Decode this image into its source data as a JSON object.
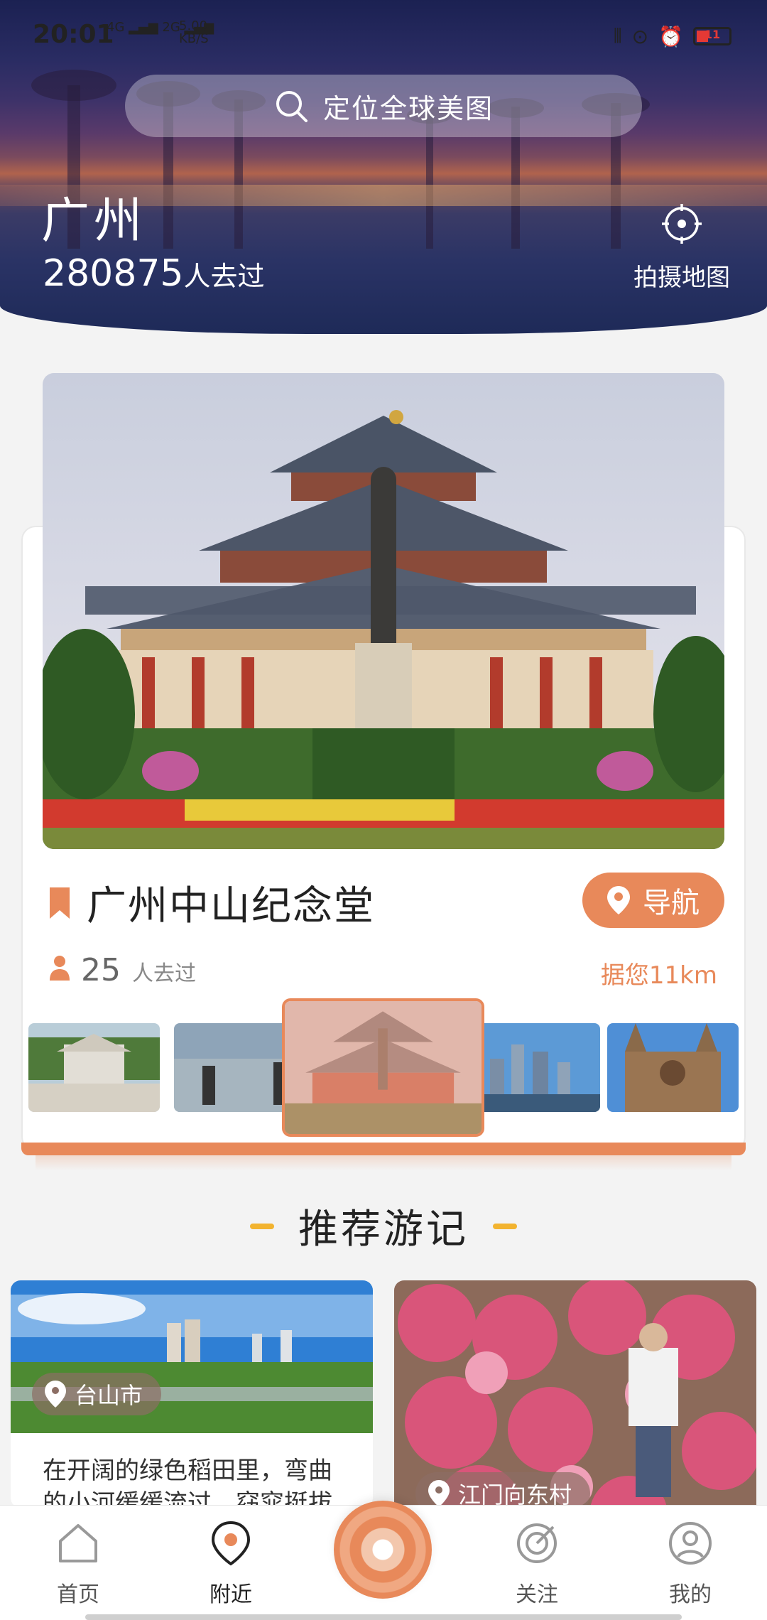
{
  "status_bar": {
    "time": "20:01",
    "network_1": "4G",
    "network_2": "2G",
    "speed": "5.00",
    "speed_unit": "KB/S",
    "battery": "11"
  },
  "search": {
    "placeholder": "定位全球美图"
  },
  "hero": {
    "city": "广州",
    "visit_count": "280875",
    "visit_label": "人去过",
    "photo_map_label": "拍摄地图"
  },
  "poi": {
    "name": "广州中山纪念堂",
    "nav_label": "导航",
    "visited_count": "25",
    "visited_label": "人去过",
    "distance": "据您11km",
    "thumbnails": [
      "thumb-1",
      "thumb-2",
      "thumb-3-active",
      "thumb-4",
      "thumb-5"
    ]
  },
  "section": {
    "title": "推荐游记"
  },
  "notes": [
    {
      "location": "台山市",
      "text": "在开阔的绿色稻田里，弯曲的小河缓缓流过，窈窕挺拔"
    },
    {
      "location": "江门向东村"
    }
  ],
  "bottom_nav": [
    {
      "label": "首页",
      "icon": "home-icon"
    },
    {
      "label": "附近",
      "icon": "location-icon"
    },
    {
      "label": "",
      "icon": "camera-center-icon"
    },
    {
      "label": "关注",
      "icon": "target-icon"
    },
    {
      "label": "我的",
      "icon": "profile-icon"
    }
  ],
  "colors": {
    "accent": "#e8895a",
    "dash": "#f2b32f"
  }
}
